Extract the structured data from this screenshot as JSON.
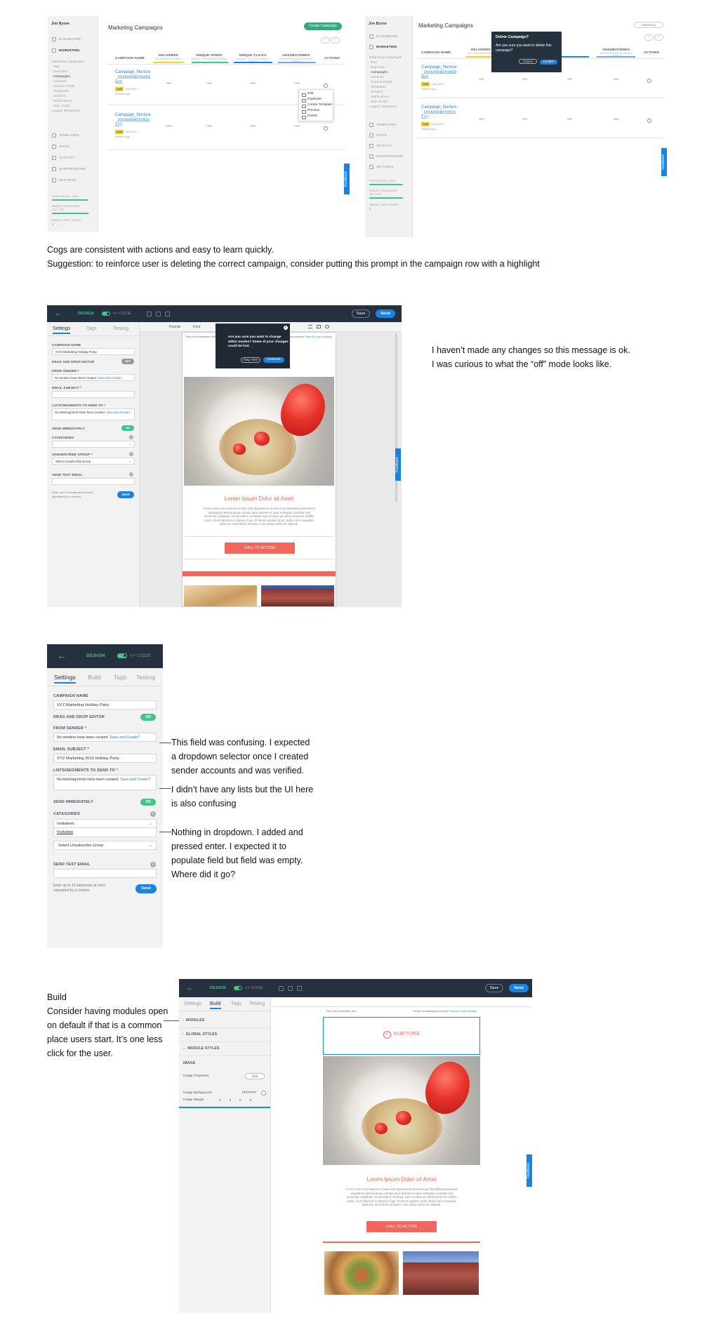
{
  "notes": {
    "cogs_1": "Cogs are consistent with actions and easy to learn quickly.",
    "cogs_2": "Suggestion: to reinforce user is deleting the correct campaign, consider putting this prompt in the campaign row with a highlight",
    "off_mode_1": "I haven’t made any changes so this message is ok.",
    "off_mode_2": "I was curious to what the “off” mode looks like.",
    "from_sender_1": "This field was confusing. I expected",
    "from_sender_2": "a dropdown selector once I created",
    "from_sender_3": "sender accounts and was verified.",
    "lists_1": "I didn’t have any lists but the UI here",
    "lists_2": "is also confusing",
    "categories_1": "Nothing in dropdown. I added and",
    "categories_2": "pressed enter. I expected it to",
    "categories_3": "populate field but field was empty.",
    "categories_4": "Where did it go?",
    "build_1": "Build",
    "build_2": "Consider having modules open",
    "build_3": "on default if that is a common",
    "build_4": "place users start. It’s one less",
    "build_5": "click for the user."
  },
  "campaigns_app": {
    "user": "Jim Byrne",
    "nav": {
      "dashboard": "Dashboard",
      "marketing": "Marketing",
      "templates": "Templates",
      "stats": "Stats",
      "activity": "Activity",
      "suppressions": "Suppressions",
      "settings": "Settings"
    },
    "sub_nav": [
      "Marketing Campaigns",
      "Tour",
      "Overview",
      "Campaigns",
      "Contacts",
      "Custom Fields",
      "Templates",
      "Senders",
      "Notifications",
      "User Guide",
      "Legacy Newsletter"
    ],
    "meters": {
      "reputation": "Reputation 100%",
      "emails_remaining": "Emails Remaining",
      "emails_remaining_value": "100 / 100",
      "emails_sent_today": "Emails Sent Today",
      "emails_sent_today_value": "0"
    },
    "title": "Marketing Campaigns",
    "create_button": "Create Campaign",
    "pager_prev": "‹",
    "pager_next": "›",
    "columns": {
      "campaign_name": "Campaign Name",
      "delivered": "Delivered",
      "delivered_sub": "No Unsubscribes",
      "unique_opens": "Unique Opens",
      "unique_opens_sub": "Unique Opens/Delivered",
      "unique_clicks": "Unique Clicks",
      "unique_clicks_sub": "Unique Clicks/Unique Opens",
      "unsubscribes": "Unsubscribes",
      "unsubscribes_sub": "Unsubscribes/Unique Opens",
      "actions": "Actions"
    },
    "colors": {
      "delivered": "#f5d22b",
      "opens": "#3cc785",
      "clicks": "#1a82e2",
      "unsubs": "#7aa6d6"
    },
    "rows_a": [
      {
        "name": "Campaign_Nurture_20160308231655420",
        "badge": "Draft",
        "meta_1": "Last Edit: 2",
        "meta_2": "minutes ago",
        "dash": "—"
      },
      {
        "name": "Campaign_Nurture_20160308231511127",
        "badge": "Draft",
        "meta_1": "Last Edit: 4",
        "meta_2": "minutes ago",
        "dash": "—"
      }
    ],
    "rows_b": [
      {
        "name": "Campaign_Nurture_20160308231655420",
        "badge": "Draft",
        "meta_1": "Last Edit: 2",
        "meta_2": "minutes ago",
        "dash": "—"
      },
      {
        "name": "Campaign_Nurture_20160308231511127",
        "badge": "Draft",
        "meta_1": "Last Edit: 4",
        "meta_2": "minutes ago",
        "dash": "—"
      }
    ],
    "action_menu": [
      "Edit",
      "Duplicate",
      "Create Template",
      "Preview",
      "Delete"
    ],
    "feedback": "Feedback",
    "dropdown_label": "Marketing",
    "delete_dialog": {
      "title": "Delete Campaign?",
      "message": "Are you sure you want to delete this campaign?",
      "cancel": "Cancel",
      "confirm": "Confirm"
    }
  },
  "editor": {
    "back": "←",
    "design": "DESIGN",
    "code": "<> CODE",
    "save": "Save",
    "send": "Send",
    "tabs_full": [
      "Settings",
      "Build",
      "Tags",
      "Testing"
    ],
    "tabs_short": [
      "Settings",
      "Tags",
      "Testing"
    ],
    "campaign_name_label": "Campaign Name",
    "campaign_name_value": "XYZ Marketing Holiday Party",
    "dnd_label": "Drag and Drop Editor",
    "dnd_on": "ON",
    "dnd_off": "OFF",
    "from_sender_label": "From Sender *",
    "from_sender_text": "No senders have been created.",
    "from_sender_link": "Save and Create?",
    "email_subject_label": "Email Subject *",
    "email_subject_value": "XYZ Marketing 2016 Holiday Party",
    "lists_label": "Lists/Segments to Send To *",
    "lists_text": "No lists/segments have been created.",
    "lists_link": "Save and Create?",
    "send_immediately_label": "Send Immediately",
    "send_immediately_state": "ON",
    "categories_label": "Categories",
    "categories_value": "Invitation|",
    "categories_option": "Invitation",
    "unsub_label": "Unsubscribe Group *",
    "unsub_value": "Select Unsubscribe Group",
    "test_email_label": "Send Test Email",
    "test_help_1": "Enter up to 10 addresses at once,",
    "test_help_2": "separated by a comma.",
    "test_send": "Send",
    "format_label": "Format",
    "font_label": "Font",
    "email_preheader": "This is the preheader text.",
    "email_view_browser": "Email not displaying correctly?",
    "email_view_link": "View it in your browser.",
    "logo_mark": "n",
    "logo_text": "NURTURE",
    "headline": "Lorem Ipsum Dolor sit Amet",
    "body_1": "At vero eos et accusamus et iusto odio dignissimos ducimus qui blanditiis praesentium",
    "body_2": "voluptatum deleniti atque corrupti quos dolores et quas molestias excepturi sint",
    "body_3": "occaecati cupiditate non provident, similique sunt in culpa qui officia deserunt mollitia",
    "body_4": "animi, id est laborum et dolorum fuga. Et harum quidem rerum facilis est et expedita",
    "body_5": "distinctio. Nam libero tempore, cum soluta nobis est eligendi.",
    "cta": "CALL TO ACTION",
    "modal_1": "Are you sure you want to change",
    "modal_2": "editor modes? Some of your changes",
    "modal_3": "could be lost.",
    "modal_stay": "Stay Here",
    "modal_continue": "Continue",
    "feedback": "Feedback",
    "build_modules": "Modules",
    "build_global": "Global Styles",
    "build_module_styles": "Module Styles",
    "build_image": "Image",
    "image_properties": "Image Properties",
    "image_edit": "Edit",
    "image_background": "Image Background",
    "image_background_value": "#FFFFFF",
    "image_margin": "Image Margin",
    "image_margin_values": [
      "0",
      "0",
      "0",
      "0"
    ]
  }
}
